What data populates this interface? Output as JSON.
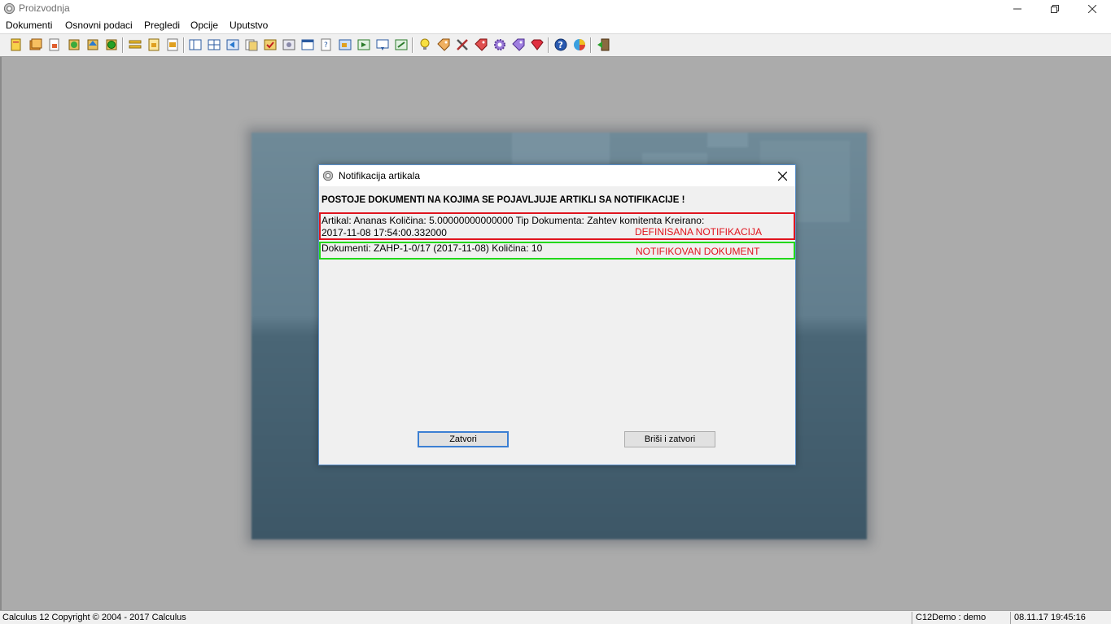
{
  "window": {
    "title": "Proizvodnja"
  },
  "menu": {
    "items": [
      "Dokumenti",
      "Osnovni podaci",
      "Pregledi",
      "Opcije",
      "Uputstvo"
    ]
  },
  "dialog": {
    "title": "Notifikacija artikala",
    "heading": "POSTOJE DOKUMENTI NA KOJIMA SE POJAVLJUJE ARTIKLI SA NOTIFIKACIJE !",
    "artikal_line1": "Artikal: Ananas Količina: 5.00000000000000 Tip Dokumenta: Zahtev komitenta Kreirano:",
    "artikal_line2": "2017-11-08 17:54:00.332000",
    "dokumenti_line": "Dokumenti: ZAHP-1-0/17 (2017-11-08) Količina: 10",
    "annotation_red": "DEFINISANA NOTIFIKACIJA",
    "annotation_green": "NOTIFIKOVAN DOKUMENT",
    "close_button": "Zatvori",
    "delete_close_button": "Briši i zatvori"
  },
  "status": {
    "copyright": "Calculus 12  Copyright © 2004 - 2017  Calculus",
    "user": "C12Demo : demo",
    "datetime": "08.11.17 19:45:16"
  },
  "colors": {
    "annotation_red": "#e0141e",
    "annotation_green": "#22d81a",
    "workspace": "#ababab"
  }
}
